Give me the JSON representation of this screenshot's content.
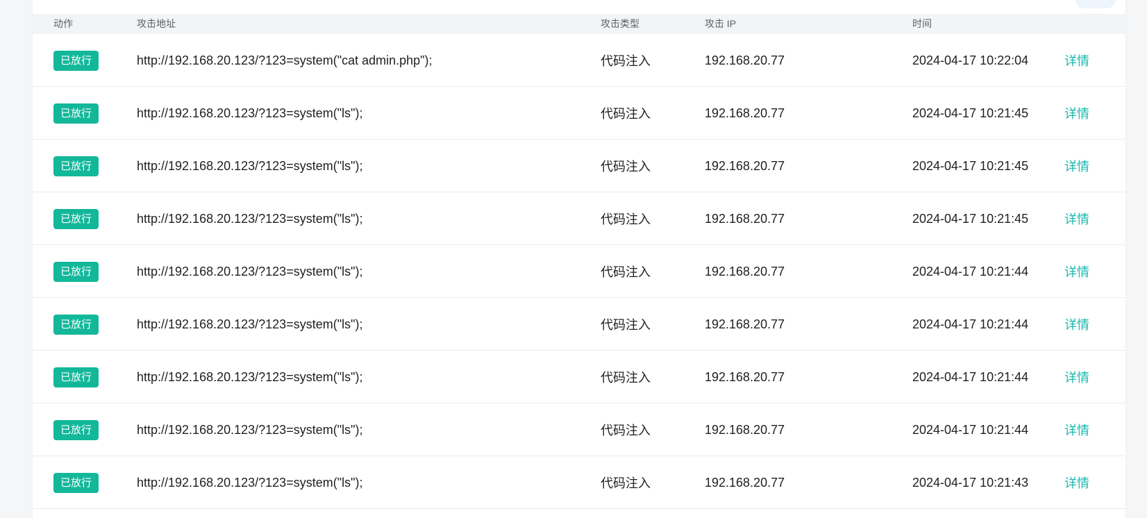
{
  "table": {
    "headers": {
      "action": "动作",
      "address": "攻击地址",
      "type": "攻击类型",
      "ip": "攻击 IP",
      "time": "时间"
    },
    "rows": [
      {
        "action": "已放行",
        "address": "http://192.168.20.123/?123=system(\"cat admin.php\");",
        "type": "代码注入",
        "ip": "192.168.20.77",
        "time": "2024-04-17 10:22:04",
        "detail": "详情"
      },
      {
        "action": "已放行",
        "address": "http://192.168.20.123/?123=system(\"ls\");",
        "type": "代码注入",
        "ip": "192.168.20.77",
        "time": "2024-04-17 10:21:45",
        "detail": "详情"
      },
      {
        "action": "已放行",
        "address": "http://192.168.20.123/?123=system(\"ls\");",
        "type": "代码注入",
        "ip": "192.168.20.77",
        "time": "2024-04-17 10:21:45",
        "detail": "详情"
      },
      {
        "action": "已放行",
        "address": "http://192.168.20.123/?123=system(\"ls\");",
        "type": "代码注入",
        "ip": "192.168.20.77",
        "time": "2024-04-17 10:21:45",
        "detail": "详情"
      },
      {
        "action": "已放行",
        "address": "http://192.168.20.123/?123=system(\"ls\");",
        "type": "代码注入",
        "ip": "192.168.20.77",
        "time": "2024-04-17 10:21:44",
        "detail": "详情"
      },
      {
        "action": "已放行",
        "address": "http://192.168.20.123/?123=system(\"ls\");",
        "type": "代码注入",
        "ip": "192.168.20.77",
        "time": "2024-04-17 10:21:44",
        "detail": "详情"
      },
      {
        "action": "已放行",
        "address": "http://192.168.20.123/?123=system(\"ls\");",
        "type": "代码注入",
        "ip": "192.168.20.77",
        "time": "2024-04-17 10:21:44",
        "detail": "详情"
      },
      {
        "action": "已放行",
        "address": "http://192.168.20.123/?123=system(\"ls\");",
        "type": "代码注入",
        "ip": "192.168.20.77",
        "time": "2024-04-17 10:21:44",
        "detail": "详情"
      },
      {
        "action": "已放行",
        "address": "http://192.168.20.123/?123=system(\"ls\");",
        "type": "代码注入",
        "ip": "192.168.20.77",
        "time": "2024-04-17 10:21:43",
        "detail": "详情"
      }
    ]
  },
  "colors": {
    "tag_background": "#13b79a",
    "link": "#1ab8b0",
    "header_background": "#f3f4f6",
    "page_background": "#f5f6f8"
  }
}
